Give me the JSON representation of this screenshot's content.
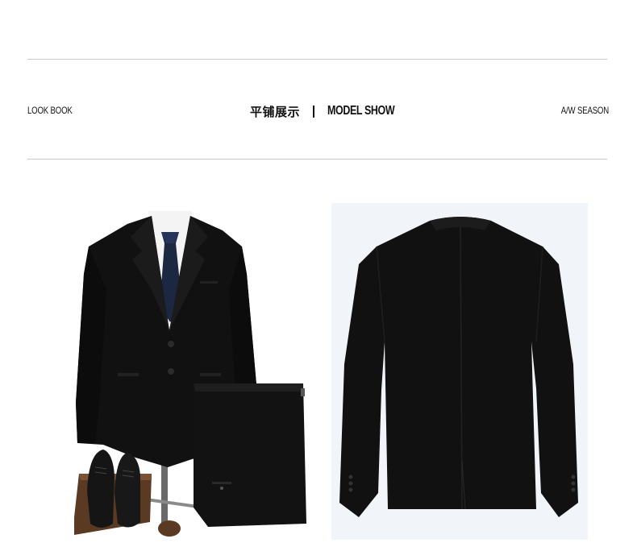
{
  "header": {
    "left_label": "LOOK BOOK",
    "title_cn": "平铺展示",
    "title_en": "MODEL SHOW",
    "right_label": "A/W SEASON"
  },
  "colors": {
    "suit": "#111111",
    "rule": "#c8c8c8",
    "back_bg": "#f1f4f8",
    "tie": "#1c2742",
    "shirt": "#f4f4f4",
    "wood": "#5a3a22"
  },
  "images": {
    "front": "suit-front-with-trousers-and-shoes",
    "back": "suit-jacket-back"
  }
}
